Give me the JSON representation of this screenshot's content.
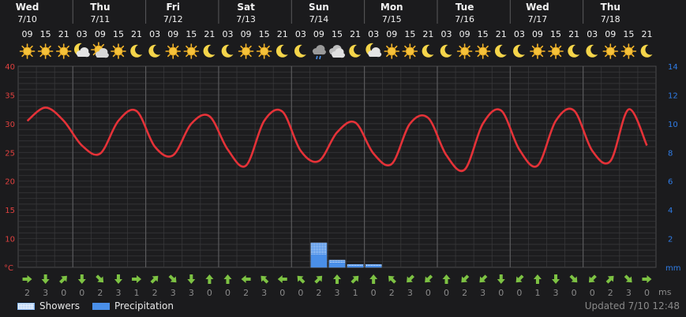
{
  "chart_data": {
    "type": "line",
    "days": [
      {
        "name": "Wed",
        "date": "7/10"
      },
      {
        "name": "Thu",
        "date": "7/11"
      },
      {
        "name": "Fri",
        "date": "7/12"
      },
      {
        "name": "Sat",
        "date": "7/13"
      },
      {
        "name": "Sun",
        "date": "7/14"
      },
      {
        "name": "Mon",
        "date": "7/15"
      },
      {
        "name": "Tue",
        "date": "7/16"
      },
      {
        "name": "Wed",
        "date": "7/17"
      },
      {
        "name": "Thu",
        "date": "7/18"
      }
    ],
    "hours": [
      "09",
      "15",
      "21",
      "03",
      "09",
      "15",
      "21",
      "03",
      "09",
      "15",
      "21",
      "03",
      "09",
      "15",
      "21",
      "03",
      "09",
      "15",
      "21",
      "03",
      "09",
      "15",
      "21",
      "03",
      "09",
      "15",
      "21",
      "03",
      "09",
      "15",
      "21",
      "03",
      "09",
      "15",
      "21"
    ],
    "icons": [
      "sun",
      "sun",
      "sun",
      "moon-cloud",
      "sun-cloud",
      "sun",
      "moon",
      "moon",
      "sun",
      "sun",
      "moon",
      "moon",
      "sun",
      "sun",
      "moon",
      "moon",
      "rain",
      "cloud",
      "moon",
      "moon-cloud",
      "sun",
      "sun",
      "moon",
      "moon",
      "sun",
      "sun",
      "moon",
      "moon",
      "sun",
      "sun",
      "moon",
      "moon",
      "sun",
      "sun",
      "moon"
    ],
    "temperature": [
      30.5,
      32.8,
      30.5,
      26.2,
      24.8,
      30.5,
      32.2,
      26.0,
      24.5,
      30.0,
      31.3,
      25.5,
      22.7,
      30.5,
      32.1,
      25.3,
      23.5,
      28.5,
      30.2,
      24.8,
      23.0,
      30.0,
      31.0,
      24.5,
      22.0,
      30.0,
      32.3,
      25.5,
      22.7,
      30.5,
      32.3,
      25.3,
      23.5,
      32.5,
      26.2
    ],
    "showers_mm": [
      0,
      0,
      0,
      0,
      0,
      0,
      0,
      0,
      0,
      0,
      0,
      0,
      0,
      0,
      0,
      0,
      1.7,
      0.5,
      0.2,
      0.2,
      0,
      0,
      0,
      0,
      0,
      0,
      0,
      0,
      0,
      0,
      0,
      0,
      0,
      0,
      0
    ],
    "precipitation_mm": [
      0,
      0,
      0,
      0,
      0,
      0,
      0,
      0,
      0,
      0,
      0,
      0,
      0,
      0,
      0,
      0,
      0.9,
      0.3,
      0.08,
      0.08,
      0,
      0,
      0,
      0,
      0,
      0,
      0,
      0,
      0,
      0,
      0,
      0,
      0,
      0,
      0
    ],
    "wind_dir": [
      "E",
      "S",
      "NE",
      "S",
      "SE",
      "S",
      "E",
      "NE",
      "SE",
      "S",
      "N",
      "N",
      "W",
      "NW",
      "W",
      "NW",
      "NE",
      "N",
      "NE",
      "N",
      "NW",
      "SW",
      "SW",
      "N",
      "SW",
      "SW",
      "S",
      "SW",
      "N",
      "S",
      "SE",
      "SW",
      "NE",
      "SE",
      "E"
    ],
    "wind_speed": [
      "2",
      "3",
      "0",
      "0",
      "2",
      "3",
      "1",
      "2",
      "3",
      "3",
      "0",
      "0",
      "2",
      "3",
      "0",
      "0",
      "2",
      "3",
      "1",
      "0",
      "2",
      "3",
      "0",
      "0",
      "2",
      "3",
      "0",
      "0",
      "1",
      "3",
      "0",
      "0",
      "2",
      "3",
      "0"
    ],
    "y_left": {
      "label": "°C",
      "ticks": [
        40,
        35,
        30,
        25,
        20,
        15,
        10
      ],
      "range": [
        5,
        40
      ]
    },
    "y_right": {
      "label": "mm",
      "ticks": [
        14,
        12,
        10,
        8,
        6,
        4,
        2
      ],
      "range": [
        0,
        14
      ]
    },
    "wind_unit": "ms",
    "colors": {
      "temperature": "#e53238",
      "precip": "#4a8fe8",
      "grid": "#3a3a3c",
      "day_divider": "#5a5a5c"
    }
  },
  "legend": {
    "showers": "Showers",
    "precipitation": "Precipitation"
  },
  "updated": "Updated 7/10 12:48"
}
